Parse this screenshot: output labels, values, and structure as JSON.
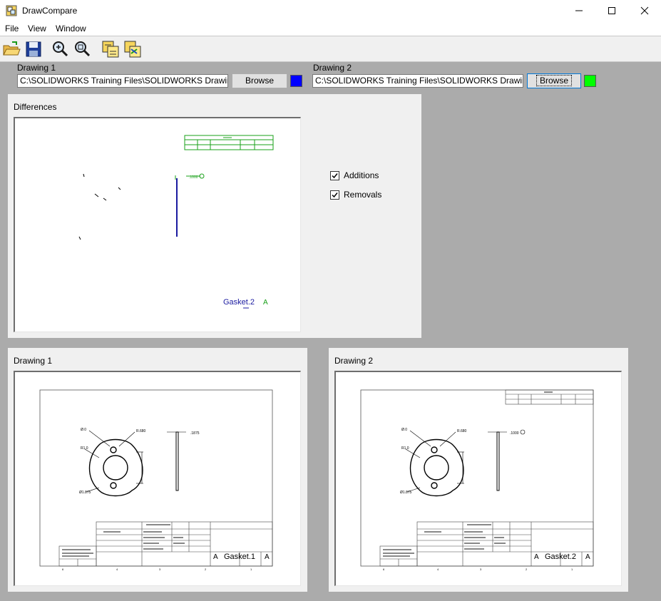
{
  "window": {
    "title": "DrawCompare",
    "controls": [
      "minimize",
      "maximize",
      "close"
    ]
  },
  "menu": {
    "items": [
      "File",
      "View",
      "Window"
    ]
  },
  "toolbar": {
    "buttons": [
      "open-folder-icon",
      "save-icon",
      "zoom-in-icon",
      "zoom-fit-icon",
      "overlay-compare-icon",
      "side-by-side-compare-icon"
    ]
  },
  "inputs": {
    "drawing1": {
      "label": "Drawing 1",
      "path": "C:\\SOLIDWORKS Training Files\\SOLIDWORKS Drawings-Al",
      "browse_label": "Browse",
      "color": "#0000ff"
    },
    "drawing2": {
      "label": "Drawing 2",
      "path": "C:\\SOLIDWORKS Training Files\\SOLIDWORKS Drawings-Al",
      "browse_label": "Browse",
      "color": "#00ff00"
    }
  },
  "differences": {
    "title": "Differences",
    "additions_label": "Additions",
    "removals_label": "Removals",
    "additions_checked": true,
    "removals_checked": true,
    "title_text": "Gasket.2",
    "rev_text": "A"
  },
  "drawing1_panel": {
    "title": "Drawing 1",
    "part_name": "Gasket.1",
    "size": "A",
    "rev": "A"
  },
  "drawing2_panel": {
    "title": "Drawing 2",
    "part_name": "Gasket.2",
    "size": "A",
    "rev": "A"
  }
}
